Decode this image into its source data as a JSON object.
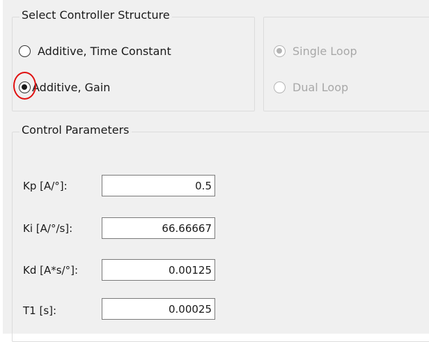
{
  "controller_structure": {
    "title": "Select Controller Structure",
    "options": [
      {
        "label": "Additive, Time Constant",
        "selected": false
      },
      {
        "label": "Additive, Gain",
        "selected": true
      }
    ]
  },
  "loop_type": {
    "options": [
      {
        "label": "Single Loop",
        "selected": true,
        "enabled": false
      },
      {
        "label": "Dual Loop",
        "selected": false,
        "enabled": false
      }
    ]
  },
  "control_parameters": {
    "title": "Control Parameters",
    "fields": [
      {
        "label": "Kp [A/°]:",
        "value": "0.5"
      },
      {
        "label": "Ki [A/°/s]:",
        "value": "66.66667"
      },
      {
        "label": "Kd [A*s/°]:",
        "value": "0.00125"
      },
      {
        "label": "T1 [s]:",
        "value": "0.00025"
      }
    ]
  },
  "annotation": {
    "highlight_color": "#e01010"
  }
}
